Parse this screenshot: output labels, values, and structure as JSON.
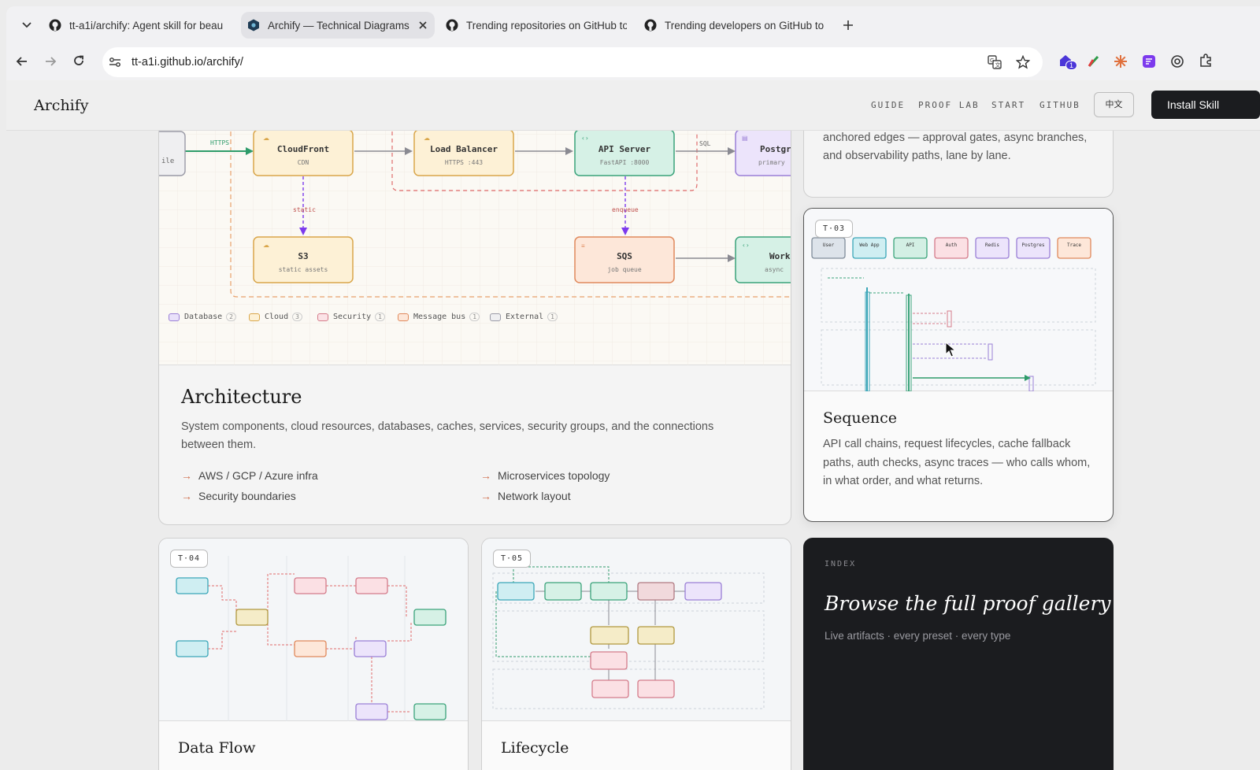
{
  "browser": {
    "tabs": [
      {
        "title": "tt-a1i/archify: Agent skill for beau"
      },
      {
        "title": "Archify — Technical Diagrams"
      },
      {
        "title": "Trending repositories on GitHub to"
      },
      {
        "title": "Trending developers on GitHub to"
      }
    ],
    "url": "tt-a1i.github.io/archify/",
    "extension_badge": "1"
  },
  "site": {
    "logo": "Archify",
    "nav": [
      "GUIDE",
      "PROOF LAB",
      "START",
      "GITHUB"
    ],
    "lang_button": "中文",
    "install_button": "Install Skill"
  },
  "architecture_card": {
    "diagram": {
      "nodes": [
        {
          "title": "CloudFront",
          "sub": "CDN"
        },
        {
          "title": "Load Balancer",
          "sub": "HTTPS :443"
        },
        {
          "title": "API Server",
          "sub": "FastAPI :8000"
        },
        {
          "title": "Postgr",
          "sub": "primary"
        },
        {
          "title": "S3",
          "sub": "static assets"
        },
        {
          "title": "SQS",
          "sub": "job queue"
        },
        {
          "title": "Work",
          "sub": "async"
        }
      ],
      "edge_labels": {
        "https": "HTTPS",
        "sql": "SQL",
        "static": "static",
        "enqueue": "enqueue",
        "left_node": "ile"
      },
      "legend": [
        {
          "label": "Database",
          "count": "2",
          "color": "#e9e1fa",
          "border": "#9a7fd6"
        },
        {
          "label": "Cloud",
          "count": "3",
          "color": "#fdf1d6",
          "border": "#d9a64a"
        },
        {
          "label": "Security",
          "count": "1",
          "color": "#fbe3e6",
          "border": "#d47b8a"
        },
        {
          "label": "Message bus",
          "count": "1",
          "color": "#fde7d9",
          "border": "#e0895c"
        },
        {
          "label": "External",
          "count": "1",
          "color": "#efeff1",
          "border": "#9a9aa6"
        }
      ]
    },
    "title": "Architecture",
    "description": "System components, cloud resources, databases, caches, services, security groups, and the connections between them.",
    "bullets": [
      "AWS / GCP / Azure infra",
      "Microservices topology",
      "Security boundaries",
      "Network layout"
    ]
  },
  "top_right_card": {
    "text": "anchored edges — approval gates, async branches, and observability paths, lane by lane."
  },
  "sequence_card": {
    "tag": "T·03",
    "participants": [
      {
        "name": "User",
        "fill": "#dde3ea",
        "stroke": "#7f8c99"
      },
      {
        "name": "Web App",
        "fill": "#cfeef2",
        "stroke": "#3aa6b8"
      },
      {
        "name": "API",
        "fill": "#d3efe4",
        "stroke": "#3aa37a"
      },
      {
        "name": "Auth",
        "fill": "#fbe0e4",
        "stroke": "#d47b8a"
      },
      {
        "name": "Redis",
        "fill": "#ece4fb",
        "stroke": "#9a7fd6"
      },
      {
        "name": "Postgres",
        "fill": "#ece4fb",
        "stroke": "#9a7fd6"
      },
      {
        "name": "Trace",
        "fill": "#fde7d9",
        "stroke": "#e0895c"
      }
    ],
    "title": "Sequence",
    "description": "API call chains, request lifecycles, cache fallback paths, auth checks, async traces — who calls whom, in what order, and what returns."
  },
  "dataflow_card": {
    "tag": "T·04",
    "title": "Data Flow"
  },
  "lifecycle_card": {
    "tag": "T·05",
    "title": "Lifecycle"
  },
  "index_card": {
    "label": "INDEX",
    "title": "Browse the full proof gallery",
    "subtitle": "Live artifacts · every preset · every type"
  },
  "colors": {
    "accent": "#d0704f",
    "dark": "#1b1c1f"
  }
}
